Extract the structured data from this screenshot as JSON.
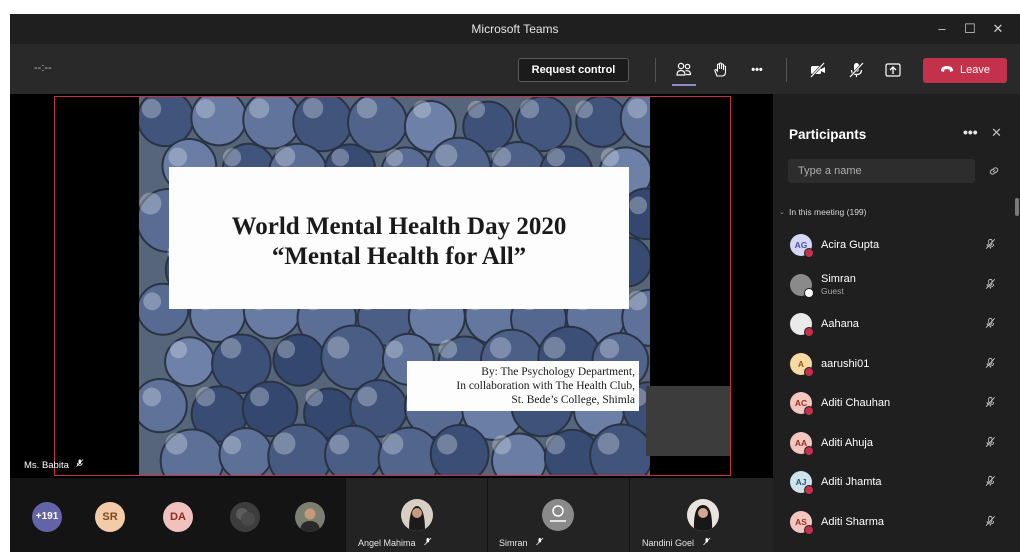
{
  "window": {
    "title": "Microsoft Teams",
    "controls": [
      "–",
      "☐",
      "✕"
    ]
  },
  "toolbar": {
    "timer": "--:--",
    "request_control_label": "Request control",
    "more_label": "•••",
    "leave_label": "Leave"
  },
  "stage": {
    "slide": {
      "title_line1": "World Mental Health Day 2020",
      "title_line2": "“Mental Health for All”",
      "credit_line1": "By:  The Psychology Department,",
      "credit_line2": "In collaboration with The Health Club,",
      "credit_line3": "St. Bede’s College, Shimla"
    },
    "speaker_name": "Ms. Babita"
  },
  "gallery": {
    "overflow_count": "+191",
    "avatars": [
      {
        "initials": "SR",
        "bg": "#f3cba9",
        "fg": "#7a4a22"
      },
      {
        "initials": "DA",
        "bg": "#f1c2bd",
        "fg": "#8a2a22"
      }
    ],
    "tiles": [
      {
        "name": "Angel Mahima"
      },
      {
        "name": "Simran"
      },
      {
        "name": "Nandini Goel"
      }
    ]
  },
  "participants": {
    "title": "Participants",
    "more_label": "•••",
    "search_placeholder": "Type a name",
    "section_label": "In this meeting (199)",
    "list": [
      {
        "name": "Acira Gupta",
        "initials": "AG",
        "bg": "#d5d7f5",
        "fg": "#4a4fa6",
        "status": "#c4314b"
      },
      {
        "name": "Simran",
        "sub": "Guest",
        "initials": "",
        "bg": "#8a8a8a",
        "fg": "#ffffff",
        "status": "#ffffff"
      },
      {
        "name": "Aahana",
        "initials": "",
        "bg": "#eaeaea",
        "fg": "#222222",
        "status": "#c4314b"
      },
      {
        "name": "aarushi01",
        "initials": "A",
        "bg": "#f7d9a4",
        "fg": "#8a5a12",
        "status": "#c4314b"
      },
      {
        "name": "Aditi Chauhan",
        "initials": "AC",
        "bg": "#f3c7c0",
        "fg": "#9a2e22",
        "status": "#c4314b"
      },
      {
        "name": "Aditi Ahuja",
        "initials": "AA",
        "bg": "#f3c7c0",
        "fg": "#9a2e22",
        "status": "#c4314b"
      },
      {
        "name": "Aditi Jhamta",
        "initials": "AJ",
        "bg": "#cfe3ec",
        "fg": "#2a5a72",
        "status": "#c4314b"
      },
      {
        "name": "Aditi Sharma",
        "initials": "AS",
        "bg": "#f3c7c0",
        "fg": "#9a2e22",
        "status": "#c4314b"
      }
    ]
  },
  "colors": {
    "accent": "#8b8cc7",
    "leave": "#c4314b",
    "panel": "#1f1f1f",
    "stage": "#000000"
  }
}
